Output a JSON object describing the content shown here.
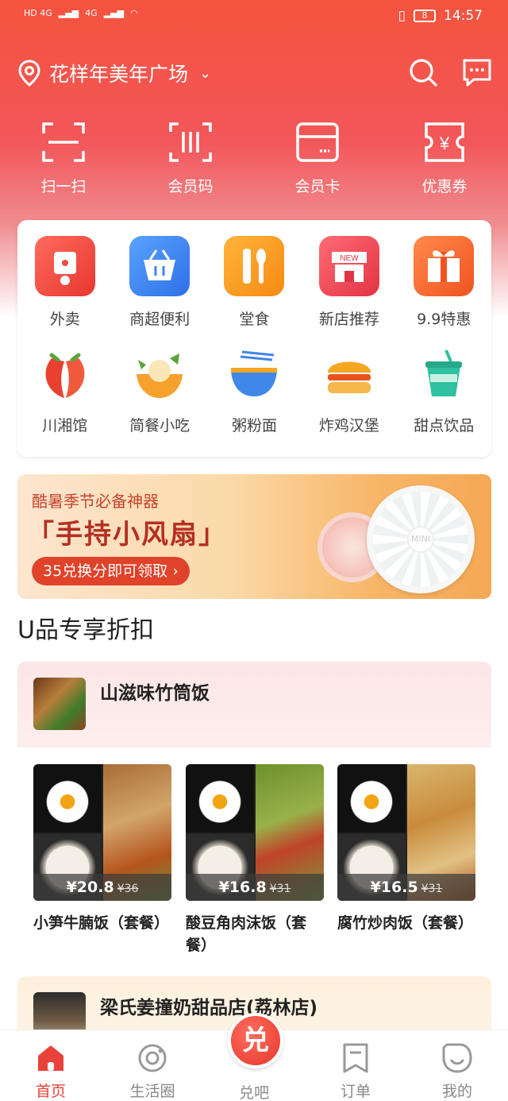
{
  "status_bar": {
    "left_net": [
      "HD 4G",
      "4G"
    ],
    "battery": "8",
    "time": "14:57"
  },
  "header": {
    "location": "花样年美年广场"
  },
  "quick_actions": [
    {
      "label": "扫一扫"
    },
    {
      "label": "会员码"
    },
    {
      "label": "会员卡"
    },
    {
      "label": "优惠券"
    }
  ],
  "categories": [
    {
      "label": "外卖",
      "color": "#f04b43"
    },
    {
      "label": "商超便利",
      "color": "#3a86f5"
    },
    {
      "label": "堂食",
      "color": "#f89c1c"
    },
    {
      "label": "新店推荐",
      "color": "#ef4652"
    },
    {
      "label": "9.9特惠",
      "color": "#f76a33"
    },
    {
      "label": "川湘馆",
      "color": "#e8412f"
    },
    {
      "label": "简餐小吃",
      "color": "#f29a2a"
    },
    {
      "label": "粥粉面",
      "color": "#3f87e8"
    },
    {
      "label": "炸鸡汉堡",
      "color": "#f5a623"
    },
    {
      "label": "甜点饮品",
      "color": "#2fc1a0"
    }
  ],
  "banner": {
    "line1": "酷暑季节必备神器",
    "line2": "「手持小风扇」",
    "cta": "35兑换分即可领取 ›",
    "fan_label": "MINI"
  },
  "section_title": "U品专享折扣",
  "shop": {
    "name": "山滋味竹筒饭"
  },
  "products": [
    {
      "price": "¥20.8",
      "original": "¥36",
      "name": "小笋牛腩饭（套餐）"
    },
    {
      "price": "¥16.8",
      "original": "¥31",
      "name": "酸豆角肉沫饭（套餐）"
    },
    {
      "price": "¥16.5",
      "original": "¥31",
      "name": "腐竹炒肉饭（套餐）"
    }
  ],
  "shop2": {
    "name": "梁氏姜撞奶甜品店(荔林店)"
  },
  "tabbar": [
    {
      "label": "首页",
      "active": true
    },
    {
      "label": "生活圈"
    },
    {
      "label": "兑吧",
      "badge": "兑"
    },
    {
      "label": "订单"
    },
    {
      "label": "我的"
    }
  ]
}
